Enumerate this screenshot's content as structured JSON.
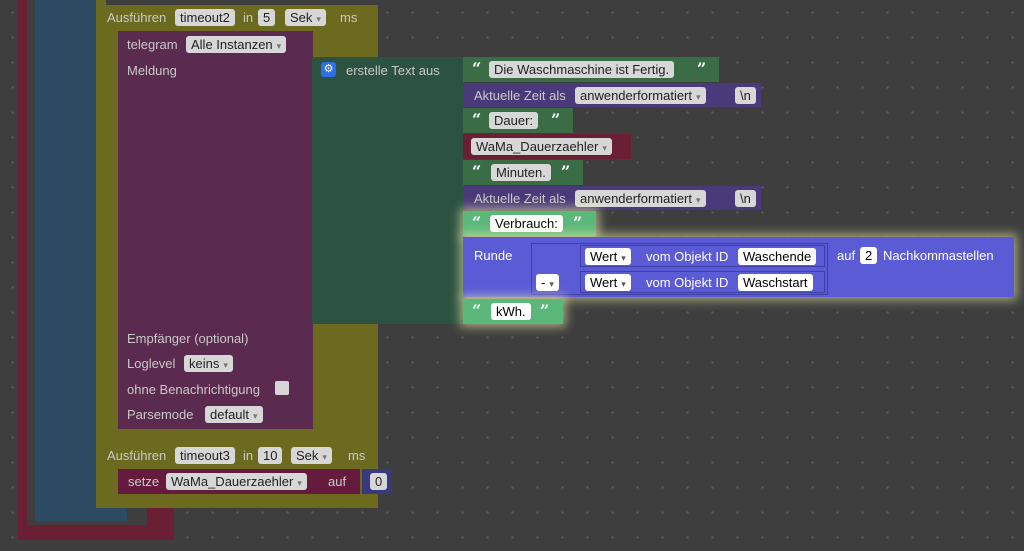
{
  "blocks": {
    "exec1": {
      "label": "Ausführen",
      "var": "timeout2",
      "in_label": "in",
      "value": "5",
      "unit": "Sek",
      "ms": "ms"
    },
    "telegram": {
      "label": "telegram",
      "instances": "Alle Instanzen",
      "message_label": "Meldung",
      "recipient_label": "Empfänger (optional)",
      "loglevel_label": "Loglevel",
      "loglevel": "keins",
      "no_notify_label": "ohne Benachrichtigung",
      "parsemode_label": "Parsemode",
      "parsemode": "default"
    },
    "create_text": {
      "label": "erstelle Text aus"
    },
    "text1": "Die Waschmaschine ist Fertig.",
    "time1": {
      "label": "Aktuelle Zeit als",
      "format": "anwenderformatiert",
      "suffix": "\\n"
    },
    "text_dauer": "Dauer:",
    "var_dauer": "WaMa_Dauerzaehler",
    "text_minuten": "Minuten.",
    "time2": {
      "label": "Aktuelle Zeit als",
      "format": "anwenderformatiert",
      "suffix": "\\n"
    },
    "text_verbrauch": "Verbrauch:",
    "round": {
      "label": "Runde",
      "decimals_label": "auf",
      "decimals": "2",
      "decimals_suffix": "Nachkommastellen",
      "op": "-",
      "value1_mode": "Wert",
      "value1_label": "vom Objekt ID",
      "value1_id": "Waschende",
      "value2_mode": "Wert",
      "value2_label": "vom Objekt ID",
      "value2_id": "Waschstart"
    },
    "text_kwh": "kWh.",
    "exec2": {
      "label": "Ausführen",
      "var": "timeout3",
      "in_label": "in",
      "value": "10",
      "unit": "Sek",
      "ms": "ms"
    },
    "set": {
      "label": "setze",
      "var": "WaMa_Dauerzaehler",
      "to_label": "auf",
      "value": "0"
    }
  },
  "icons": {
    "quote_open": "“",
    "quote_close": "”",
    "gear": "⚙",
    "dropdown": "▾"
  }
}
